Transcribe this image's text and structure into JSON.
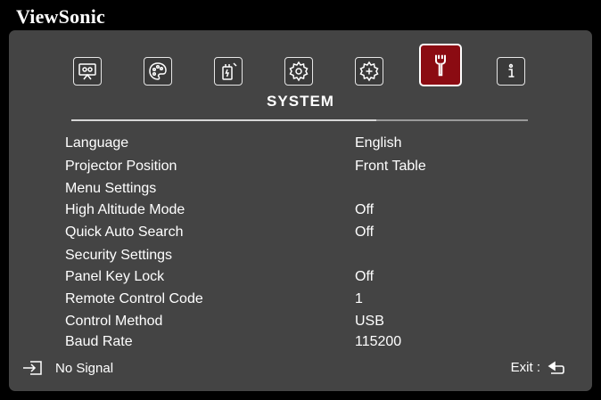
{
  "brand": "ViewSonic",
  "tabs": [
    {
      "name": "display",
      "icon": "display-icon",
      "active": false
    },
    {
      "name": "image",
      "icon": "palette-icon",
      "active": false
    },
    {
      "name": "power",
      "icon": "power-management-icon",
      "active": false
    },
    {
      "name": "basic",
      "icon": "gear-icon",
      "active": false
    },
    {
      "name": "advanced",
      "icon": "gear-plus-icon",
      "active": false
    },
    {
      "name": "system",
      "icon": "wrench-icon",
      "active": true
    },
    {
      "name": "information",
      "icon": "info-icon",
      "active": false
    }
  ],
  "section_title": "SYSTEM",
  "menu": [
    {
      "label": "Language",
      "value": "English"
    },
    {
      "label": "Projector Position",
      "value": "Front Table"
    },
    {
      "label": "Menu Settings",
      "value": ""
    },
    {
      "label": "High Altitude Mode",
      "value": "Off"
    },
    {
      "label": "Quick Auto Search",
      "value": "Off"
    },
    {
      "label": "Security Settings",
      "value": ""
    },
    {
      "label": "Panel Key Lock",
      "value": "Off"
    },
    {
      "label": "Remote Control Code",
      "value": "1"
    },
    {
      "label": "Control Method",
      "value": "USB"
    },
    {
      "label": "Baud Rate",
      "value": "115200"
    }
  ],
  "status": {
    "icon": "input-source-icon",
    "text": "No Signal"
  },
  "exit": {
    "label": "Exit :",
    "icon": "return-icon"
  },
  "colors": {
    "panel": "#444444",
    "active_tab": "#8b0b12",
    "background": "#000000"
  }
}
